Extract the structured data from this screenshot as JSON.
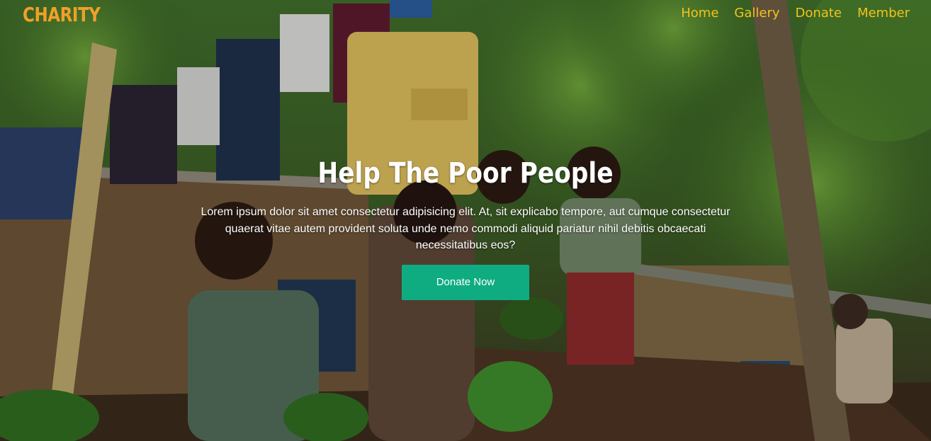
{
  "brand": {
    "logo": "CHARITY",
    "logo_color": "#f0a02a"
  },
  "nav": {
    "color": "#f3c21b",
    "items": [
      {
        "label": "Home"
      },
      {
        "label": "Gallery"
      },
      {
        "label": "Donate"
      },
      {
        "label": "Member"
      }
    ]
  },
  "hero": {
    "title": "Help The Poor People",
    "description": "Lorem ipsum dolor sit amet consectetur adipisicing elit. At, sit explicabo tempore, aut cumque consectetur quaerat vitae autem provident soluta unde nemo commodi aliquid pariatur nihil debitis obcaecati necessitatibus eos?",
    "cta_label": "Donate Now",
    "cta_color": "#0fac81"
  }
}
